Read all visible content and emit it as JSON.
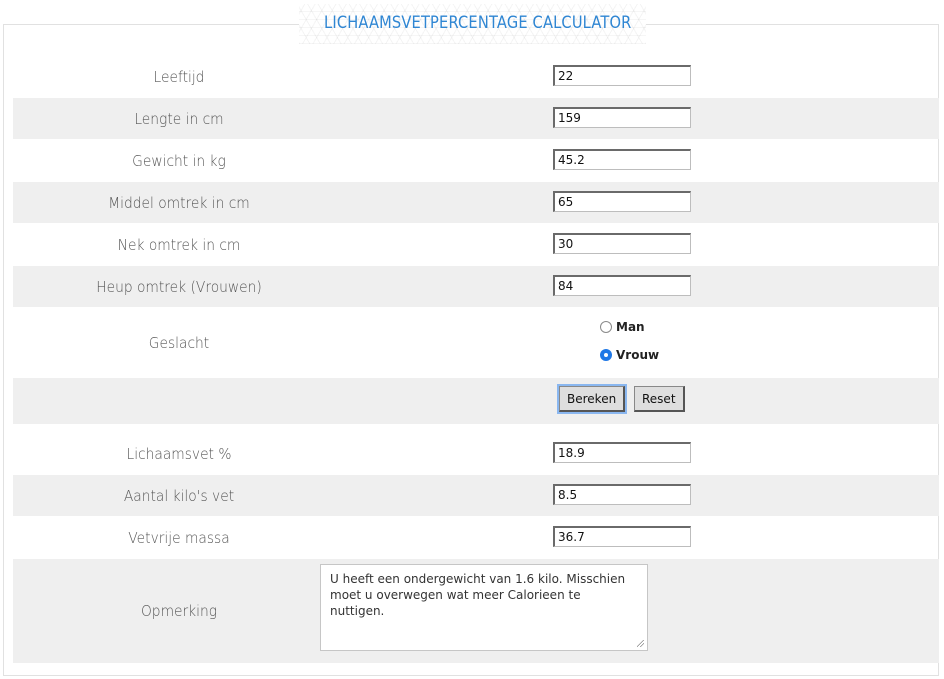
{
  "title": "LICHAAMSVETPERCENTAGE CALCULATOR",
  "inputs": [
    {
      "label": "Leeftijd",
      "value": "22"
    },
    {
      "label": "Lengte in cm",
      "value": "159"
    },
    {
      "label": "Gewicht in kg",
      "value": "45.2"
    },
    {
      "label": "Middel omtrek in cm",
      "value": "65"
    },
    {
      "label": "Nek omtrek in cm",
      "value": "30"
    },
    {
      "label": "Heup omtrek (Vrouwen)",
      "value": "84"
    }
  ],
  "gender": {
    "label": "Geslacht",
    "options": [
      {
        "label": "Man",
        "checked": false
      },
      {
        "label": "Vrouw",
        "checked": true
      }
    ]
  },
  "buttons": {
    "calculate": "Bereken",
    "reset": "Reset"
  },
  "results": [
    {
      "label": "Lichaamsvet %",
      "value": "18.9"
    },
    {
      "label": "Aantal kilo's vet",
      "value": "8.5"
    },
    {
      "label": "Vetvrije massa",
      "value": "36.7"
    }
  ],
  "remark": {
    "label": "Opmerking",
    "text": "U heeft een ondergewicht van 1.6 kilo. Misschien moet u overwegen wat meer Calorieen te nuttigen."
  },
  "colors": {
    "title": "#2f86d3",
    "row_alt": "#efefef",
    "radio_checked": "#1f78e6"
  }
}
